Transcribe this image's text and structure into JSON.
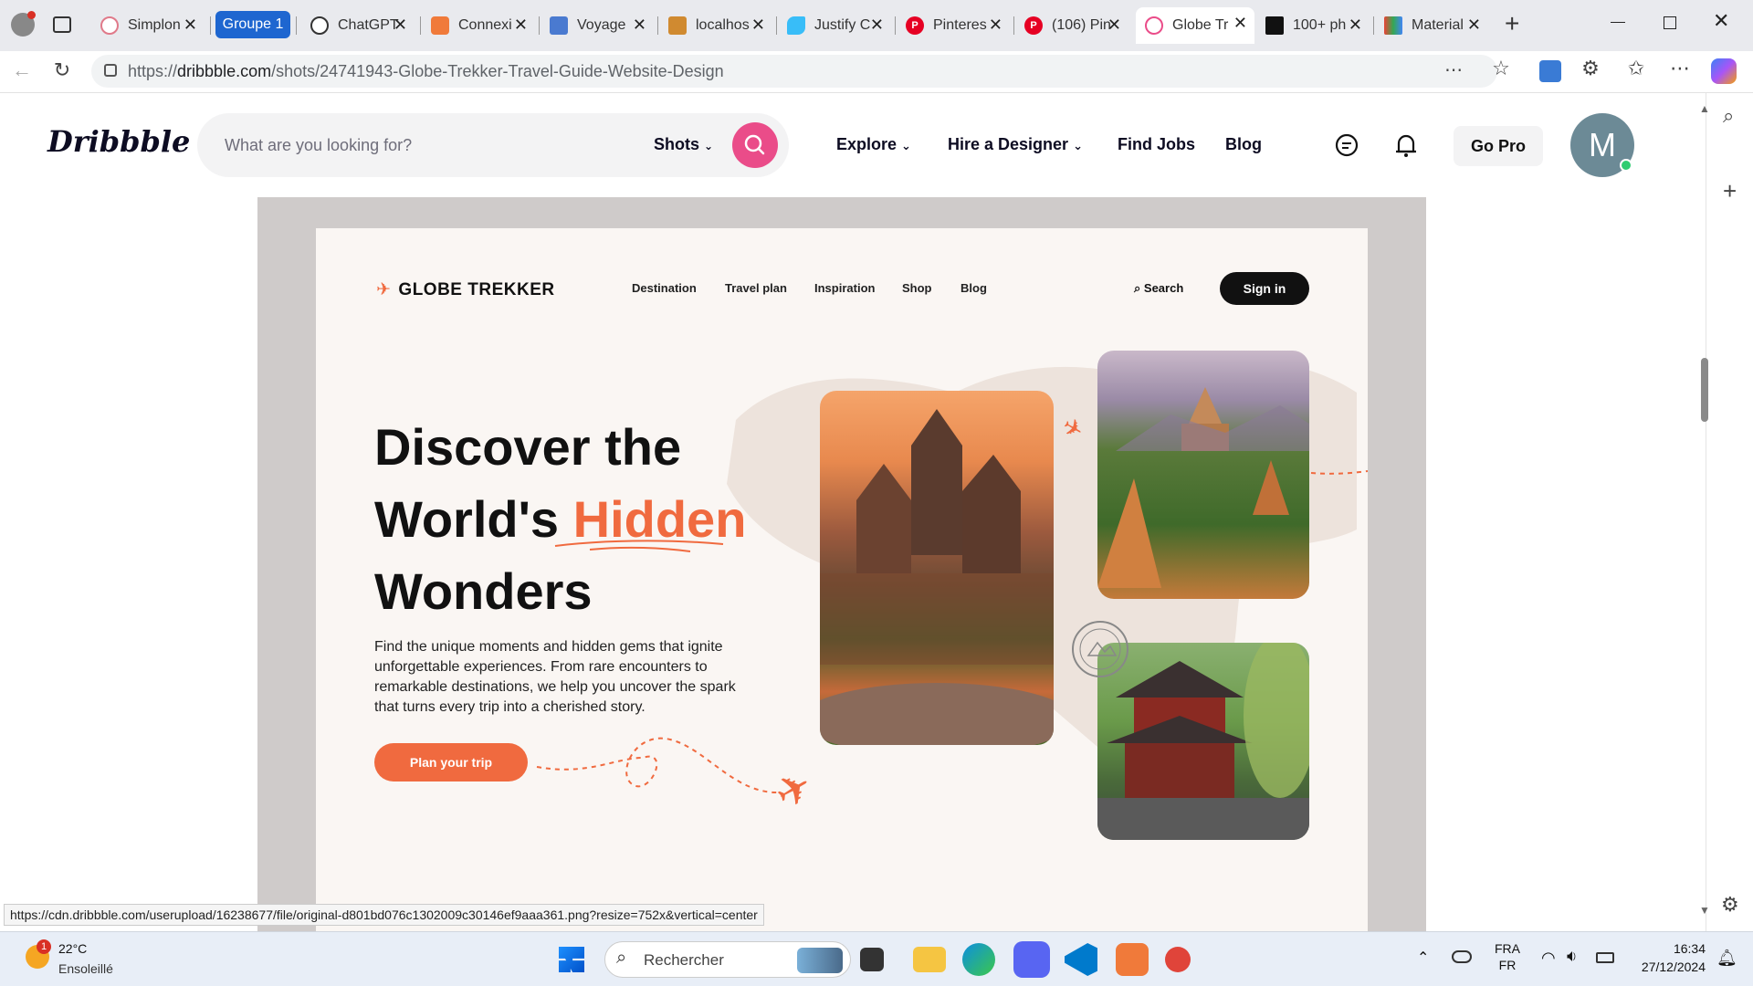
{
  "browser": {
    "tabs": [
      {
        "label": "Simplon",
        "color": "#e07a8a"
      },
      {
        "label": "Groupe 1",
        "color": "#1e66d0"
      },
      {
        "label": "ChatGPT",
        "color": "#333333"
      },
      {
        "label": "Connexi",
        "color": "#f07a3a"
      },
      {
        "label": "Voyage",
        "color": "#4a7ad0"
      },
      {
        "label": "localhos",
        "color": "#d08a30"
      },
      {
        "label": "Justify C",
        "color": "#38bdf8"
      },
      {
        "label": "Pinteres",
        "color": "#e60023"
      },
      {
        "label": "(106) Pin",
        "color": "#e60023"
      },
      {
        "label": "Globe Tr",
        "color": "#ea4c89"
      },
      {
        "label": "100+ ph",
        "color": "#111111"
      },
      {
        "label": "Material",
        "color": "#34a853"
      }
    ],
    "url_prefix": "https://",
    "url_domain": "dribbble.com",
    "url_path": "/shots/24741943-Globe-Trekker-Travel-Guide-Website-Design",
    "status_url": "https://cdn.dribbble.com/userupload/16238677/file/original-d801bd076c1302009c30146ef9aaa361.png?resize=752x&vertical=center"
  },
  "dribbble": {
    "logo": "Dribbble",
    "search_placeholder": "What are you looking for?",
    "search_scope": "Shots",
    "nav": [
      "Explore",
      "Hire a Designer",
      "Find Jobs",
      "Blog"
    ],
    "go_pro": "Go Pro",
    "avatar_initial": "M"
  },
  "shot": {
    "brand": "GLOBE TREKKER",
    "nav": [
      "Destination",
      "Travel plan",
      "Inspiration",
      "Shop",
      "Blog"
    ],
    "search": "Search",
    "sign_in": "Sign in",
    "hero_line1": "Discover the",
    "hero_line2a": "World's",
    "hero_line2b": "Hidden",
    "hero_line3": "Wonders",
    "description": "Find the unique moments and hidden gems that ignite unforgettable experiences. From rare encounters to remarkable destinations, we help you uncover the spark that turns every trip into a cherished story.",
    "cta": "Plan your trip",
    "accent": "#f06a3f"
  },
  "taskbar": {
    "temp": "22°C",
    "weather": "Ensoleillé",
    "weather_badge": "1",
    "search": "Rechercher",
    "lang1": "FRA",
    "lang2": "FR",
    "time": "16:34",
    "date": "27/12/2024"
  }
}
